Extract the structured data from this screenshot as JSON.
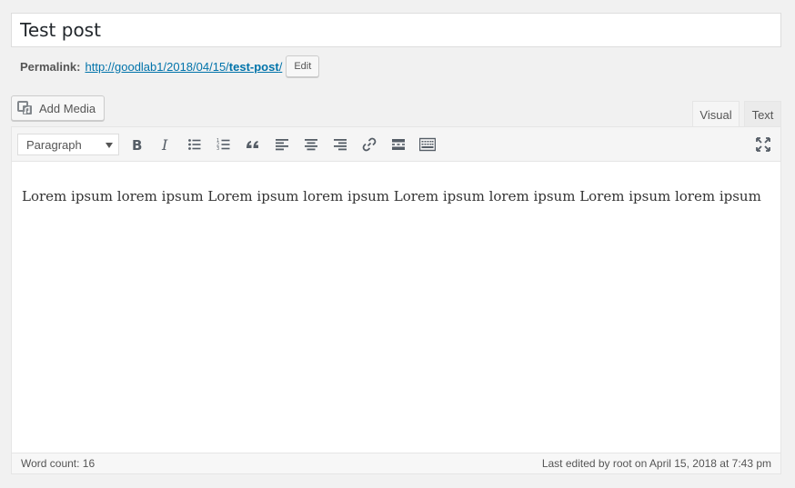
{
  "title": {
    "value": "Test post"
  },
  "permalink": {
    "label": "Permalink:",
    "url_base": "http://goodlab1/2018/04/15/",
    "slug": "test-post",
    "url_end": "/",
    "edit_label": "Edit"
  },
  "add_media_label": "Add Media",
  "tabs": {
    "visual": "Visual",
    "text": "Text"
  },
  "toolbar": {
    "format_value": "Paragraph"
  },
  "content": {
    "text": "Lorem ipsum lorem ipsum Lorem ipsum lorem ipsum Lorem ipsum lorem ipsum Lorem ipsum lorem ipsum"
  },
  "status": {
    "word_count": "Word count: 16",
    "last_edited": "Last edited by root on April 15, 2018 at 7:43 pm"
  },
  "colors": {
    "link": "#0073aa",
    "icon": "#555d66"
  },
  "icons": [
    "bold-icon",
    "italic-icon",
    "bulleted-list-icon",
    "numbered-list-icon",
    "blockquote-icon",
    "align-left-icon",
    "align-center-icon",
    "align-right-icon",
    "link-icon",
    "read-more-icon",
    "toolbar-toggle-icon",
    "fullscreen-icon"
  ]
}
